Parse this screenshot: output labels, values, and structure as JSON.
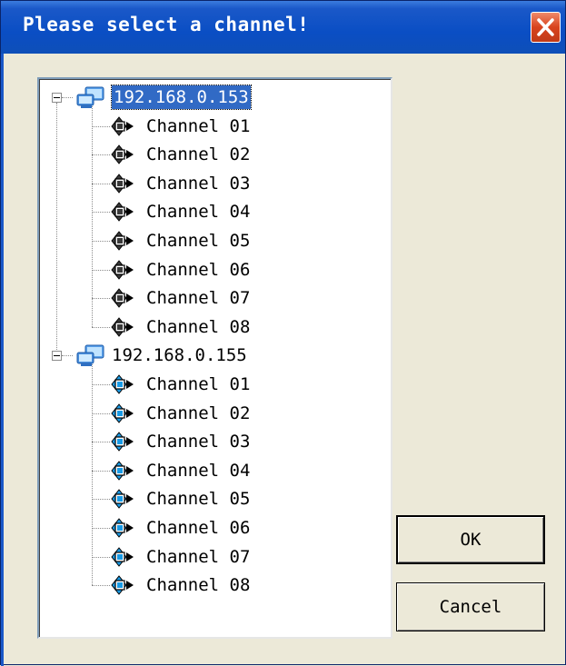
{
  "window": {
    "title": "Please select a channel!"
  },
  "tree": {
    "nodes": [
      {
        "label": "192.168.0.153",
        "selected": true,
        "icon": "network-computer-icon",
        "channel_icon": "camera-offline-icon",
        "channel_color": "#3a3a3a",
        "channels": [
          "Channel 01",
          "Channel 02",
          "Channel 03",
          "Channel 04",
          "Channel 05",
          "Channel 06",
          "Channel 07",
          "Channel 08"
        ]
      },
      {
        "label": "192.168.0.155",
        "selected": false,
        "icon": "network-computer-icon",
        "channel_icon": "camera-online-icon",
        "channel_color": "#1a9be6",
        "channels": [
          "Channel 01",
          "Channel 02",
          "Channel 03",
          "Channel 04",
          "Channel 05",
          "Channel 06",
          "Channel 07",
          "Channel 08"
        ]
      }
    ]
  },
  "buttons": {
    "ok": "OK",
    "cancel": "Cancel"
  }
}
